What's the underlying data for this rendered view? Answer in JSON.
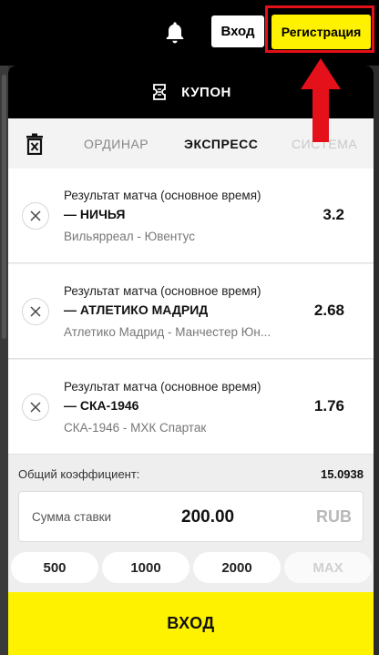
{
  "header": {
    "login_label": "Вход",
    "register_label": "Регистрация",
    "bell_icon": "bell-icon"
  },
  "coupon": {
    "title": "КУПОН",
    "icon": "ticket-icon"
  },
  "tabs": [
    {
      "label": "ОРДИНАР",
      "active": false
    },
    {
      "label": "ЭКСПРЕСС",
      "active": true
    },
    {
      "label": "СИСТЕМА",
      "active": false
    }
  ],
  "bets": [
    {
      "market": "Результат матча (основное время)",
      "outcome": "— НИЧЬЯ",
      "event": "Вильярреал - Ювентус",
      "odds": "3.2"
    },
    {
      "market": "Результат матча (основное время)",
      "outcome": "— АТЛЕТИКО МАДРИД",
      "event": "Атлетико Мадрид - Манчестер Юн...",
      "odds": "2.68"
    },
    {
      "market": "Результат матча (основное время)",
      "outcome": "— СКА-1946",
      "event": "СКА-1946 - МХК Спартак",
      "odds": "1.76"
    }
  ],
  "summary": {
    "total_label": "Общий коэффициент:",
    "total_value": "15.0938"
  },
  "stake": {
    "label": "Сумма ставки",
    "value": "200.00",
    "currency": "RUB"
  },
  "quick_amounts": [
    "500",
    "1000",
    "2000",
    "MAX"
  ],
  "login_button_label": "ВХОД",
  "colors": {
    "accent_yellow": "#fff200",
    "highlight_red": "#e4101a",
    "header_black": "#000000"
  }
}
